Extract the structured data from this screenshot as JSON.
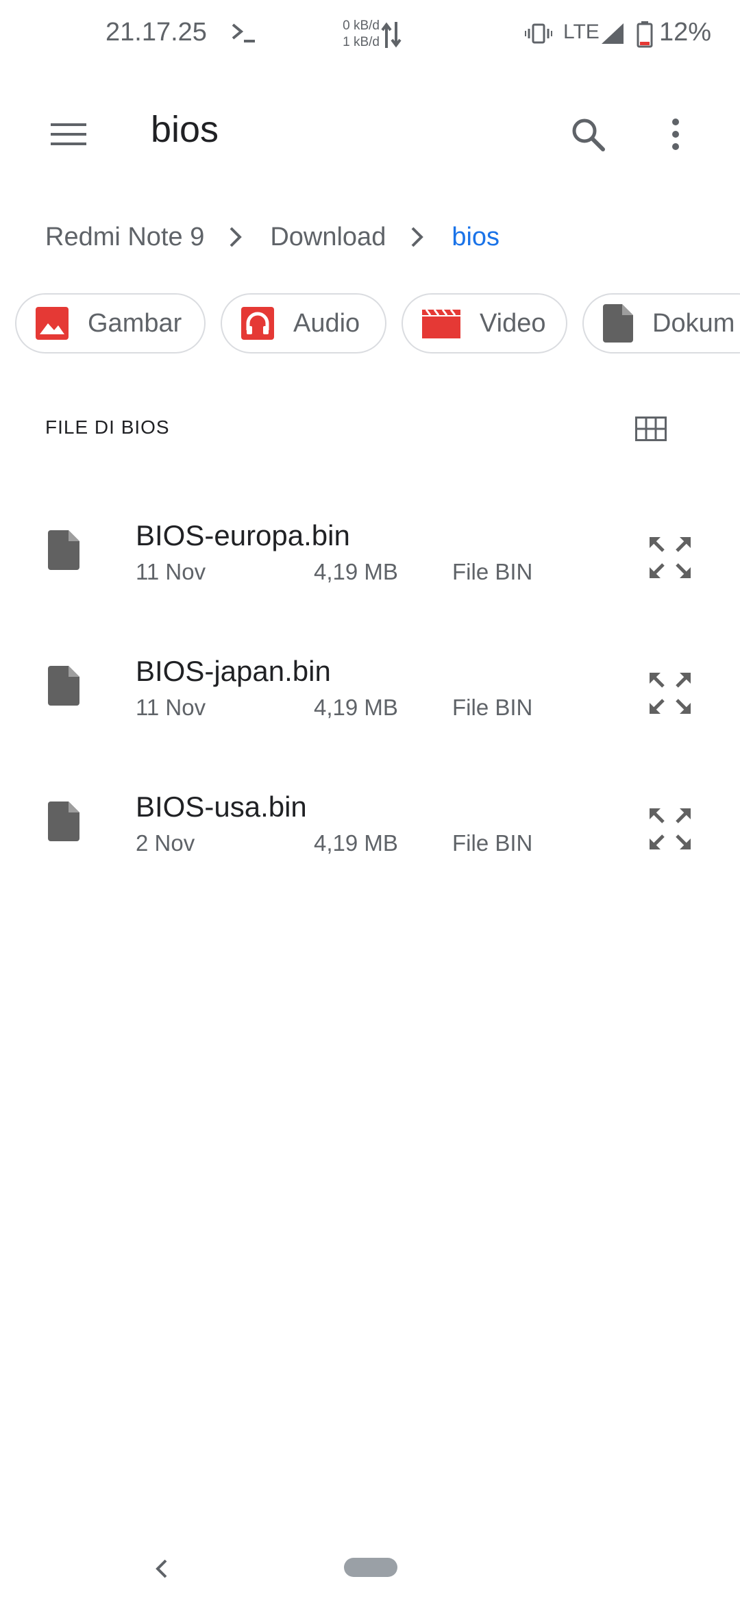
{
  "status_bar": {
    "time": "21.17.25",
    "net_up": "0 kB/d",
    "net_down": "1 kB/d",
    "network": "LTE",
    "battery": "12%",
    "icons": [
      "terminal-icon",
      "data-arrows-icon",
      "vibrate-icon",
      "signal-icon",
      "battery-icon"
    ]
  },
  "app_bar": {
    "title": "bios",
    "icons": [
      "menu-icon",
      "search-icon",
      "more-vert-icon"
    ]
  },
  "breadcrumb": {
    "items": [
      "Redmi Note 9",
      "Download",
      "bios"
    ]
  },
  "chips": [
    {
      "label": "Gambar",
      "icon": "image-icon",
      "color": "#e53935"
    },
    {
      "label": "Audio",
      "icon": "headphones-icon",
      "color": "#e53935"
    },
    {
      "label": "Video",
      "icon": "movie-icon",
      "color": "#e53935"
    },
    {
      "label": "Dokum",
      "icon": "document-icon",
      "color": "#616161"
    }
  ],
  "section": {
    "title": "FILE DI BIOS",
    "view_toggle_icon": "grid-view-icon"
  },
  "files": [
    {
      "name": "BIOS-europa.bin",
      "date": "11 Nov",
      "size": "4,19 MB",
      "type": "File BIN"
    },
    {
      "name": "BIOS-japan.bin",
      "date": "11 Nov",
      "size": "4,19 MB",
      "type": "File BIN"
    },
    {
      "name": "BIOS-usa.bin",
      "date": "2 Nov",
      "size": "4,19 MB",
      "type": "File BIN"
    }
  ],
  "colors": {
    "accent": "#1a73e8",
    "chip_red": "#e53935",
    "icon_gray": "#616161",
    "text_secondary": "#5f6368"
  }
}
